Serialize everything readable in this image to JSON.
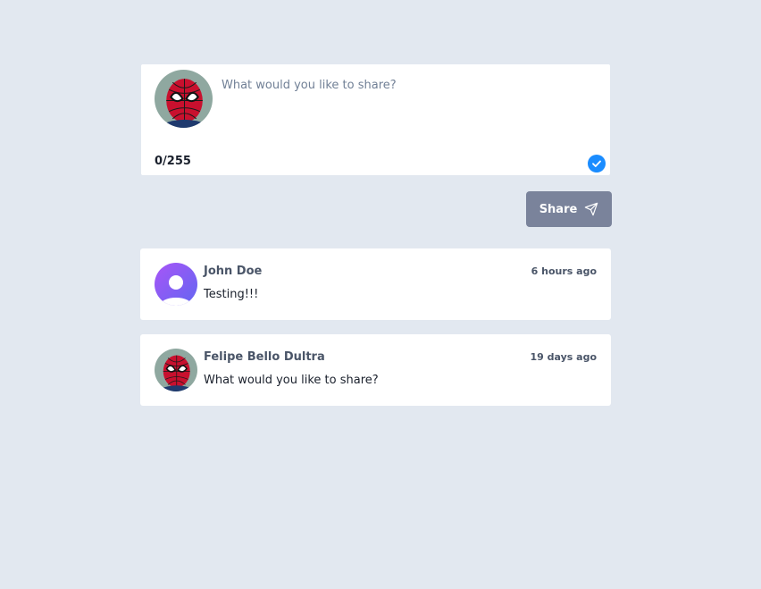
{
  "composer": {
    "placeholder": "What would you like to share?",
    "value": "",
    "counter": "0/255"
  },
  "share_button": {
    "label": "Share",
    "icon": "send-icon"
  },
  "posts": [
    {
      "author": "John Doe",
      "time": "6 hours ago",
      "content": "Testing!!!",
      "avatar": "default-user-icon"
    },
    {
      "author": "Felipe Bello Dultra",
      "time": "19 days ago",
      "content": "What would you like to share?",
      "avatar": "spiderman-avatar"
    }
  ],
  "colors": {
    "background": "#e2e8f0",
    "accent": "#1a8cff",
    "button": "#7a839b",
    "avatar_gradient_start": "#a855f7",
    "avatar_gradient_end": "#6366f1"
  }
}
